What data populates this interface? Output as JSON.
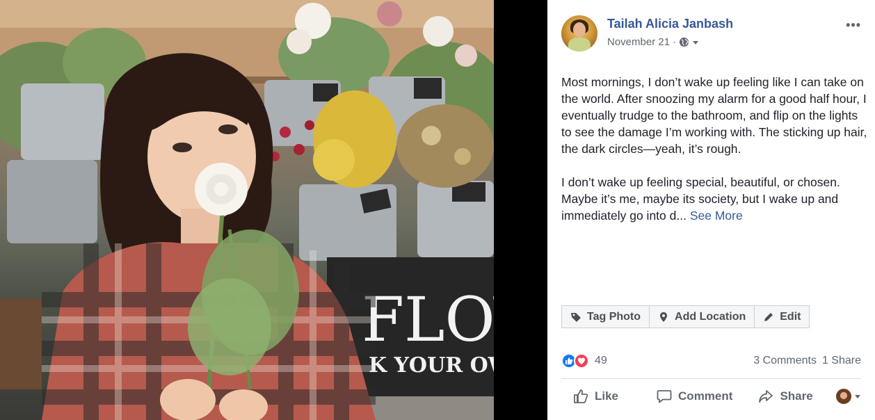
{
  "post": {
    "author": "Tailah Alicia Janbash",
    "date": "November 21",
    "separator": "·",
    "paragraph1": "Most mornings, I don’t wake up feeling like I can take on the world. After snoozing my alarm for a good half hour, I eventually trudge to the bathroom, and flip on the lights to see the damage I’m working with. The sticking up hair, the dark circles—yeah, it’s rough.",
    "paragraph2": "I don’t wake up feeling special, beautiful, or chosen. Maybe it’s me, maybe its society, but I wake up and immediately go into d...",
    "see_more": "See More",
    "more_options": "•••"
  },
  "photo_actions": {
    "tag_photo": "Tag Photo",
    "add_location": "Add Location",
    "edit": "Edit"
  },
  "reactions": {
    "count": "49",
    "comments": "3 Comments",
    "shares": "1 Share"
  },
  "bottom_bar": {
    "like": "Like",
    "comment": "Comment",
    "share": "Share"
  },
  "photo": {
    "sign_text_1": "FLOV",
    "sign_text_2": "K YOUR OWI"
  },
  "colors": {
    "link_blue": "#365899",
    "like_blue": "#1877f2",
    "love_red": "#f33e58"
  },
  "icons": [
    "globe-icon",
    "caret-down-icon",
    "tag-icon",
    "location-pin-icon",
    "pencil-icon",
    "like-thumb-icon",
    "heart-icon",
    "comment-icon",
    "share-arrow-icon"
  ]
}
